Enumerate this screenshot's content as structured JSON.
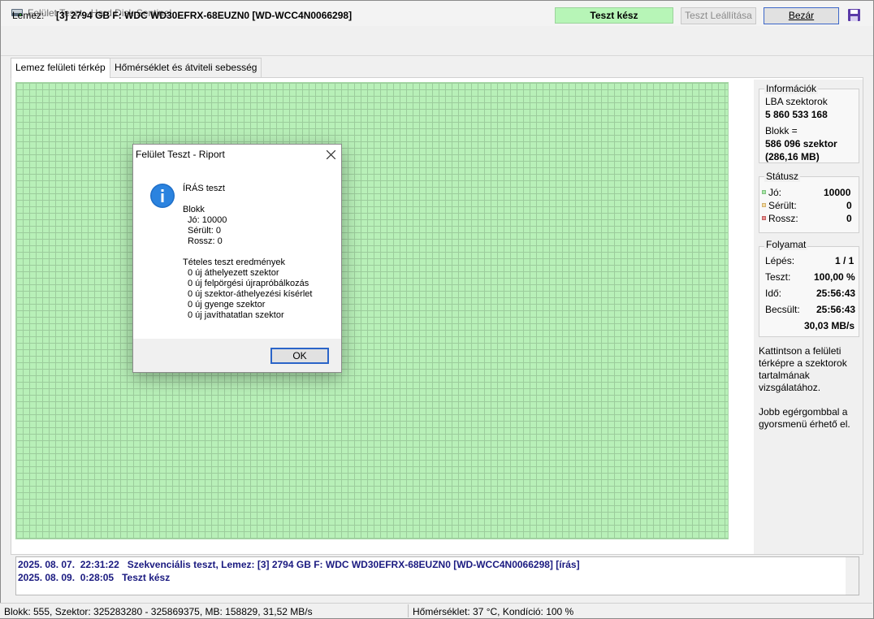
{
  "window": {
    "title": "Felület Teszt - Hard Disk Sentinel"
  },
  "disk": {
    "label": "Lemez:",
    "value": "[3] 2794 GB F: WDC WD30EFRX-68EUZN0 [WD-WCC4N0066298]"
  },
  "toolbar": {
    "status": "Teszt kész",
    "stop_label": "Teszt Leállítása",
    "close_label": "Bezár"
  },
  "tabs": [
    {
      "label": "Lemez felületi térkép"
    },
    {
      "label": "Hőmérséklet és átviteli sebesség"
    }
  ],
  "info": {
    "title": "Információk",
    "lba_label": "LBA szektorok",
    "lba_value": "5 860 533 168",
    "block_label": "Blokk =",
    "block_value": "586 096 szektor",
    "block_size": "(286,16 MB)"
  },
  "status": {
    "title": "Státusz",
    "good_label": "Jó:",
    "good_value": "10000",
    "damaged_label": "Sérült:",
    "damaged_value": "0",
    "bad_label": "Rossz:",
    "bad_value": "0",
    "colors": {
      "good": "#a8e8a8",
      "damaged": "#f5dca0",
      "bad": "#e89090"
    }
  },
  "progress": {
    "title": "Folyamat",
    "step_label": "Lépés:",
    "step_value": "1 / 1",
    "test_label": "Teszt:",
    "test_value": "100,00 %",
    "time_label": "Idő:",
    "time_value": "25:56:43",
    "est_label": "Becsült:",
    "est_value": "25:56:43",
    "speed_value": "30,03 MB/s"
  },
  "help": {
    "line1": [
      "Kattintson a felületi",
      "térképre a szektorok",
      "tartalmának",
      "vizsgálatához."
    ],
    "line2": [
      "Jobb egérgombbal a",
      "gyorsmenü érhető el."
    ]
  },
  "log": [
    "2025. 08. 07.  22:31:22   Szekvenciális teszt, Lemez: [3] 2794 GB F: WDC WD30EFRX-68EUZN0 [WD-WCC4N0066298] [írás]",
    "2025. 08. 09.  0:28:05   Teszt kész"
  ],
  "statusbar": {
    "left": "Blokk: 555, Szektor: 325283280 - 325869375, MB: 158829, 31,52 MB/s",
    "right": "Hőmérséklet: 37  °C,  Kondíció: 100 %"
  },
  "dialog": {
    "title": "Felület Teszt - Riport",
    "heading": "ÍRÁS teszt",
    "block_title": "Blokk",
    "block_lines": [
      "Jó: 10000",
      "Sérült: 0",
      "Rossz: 0"
    ],
    "results_title": "Tételes teszt eredmények",
    "results_lines": [
      "0 új áthelyezett szektor",
      "0 új felpörgési újrapróbálkozás",
      "0 új szektor-áthelyezési kísérlet",
      "0 új gyenge szektor",
      "0 új javíthatatlan szektor"
    ],
    "ok_label": "OK"
  }
}
